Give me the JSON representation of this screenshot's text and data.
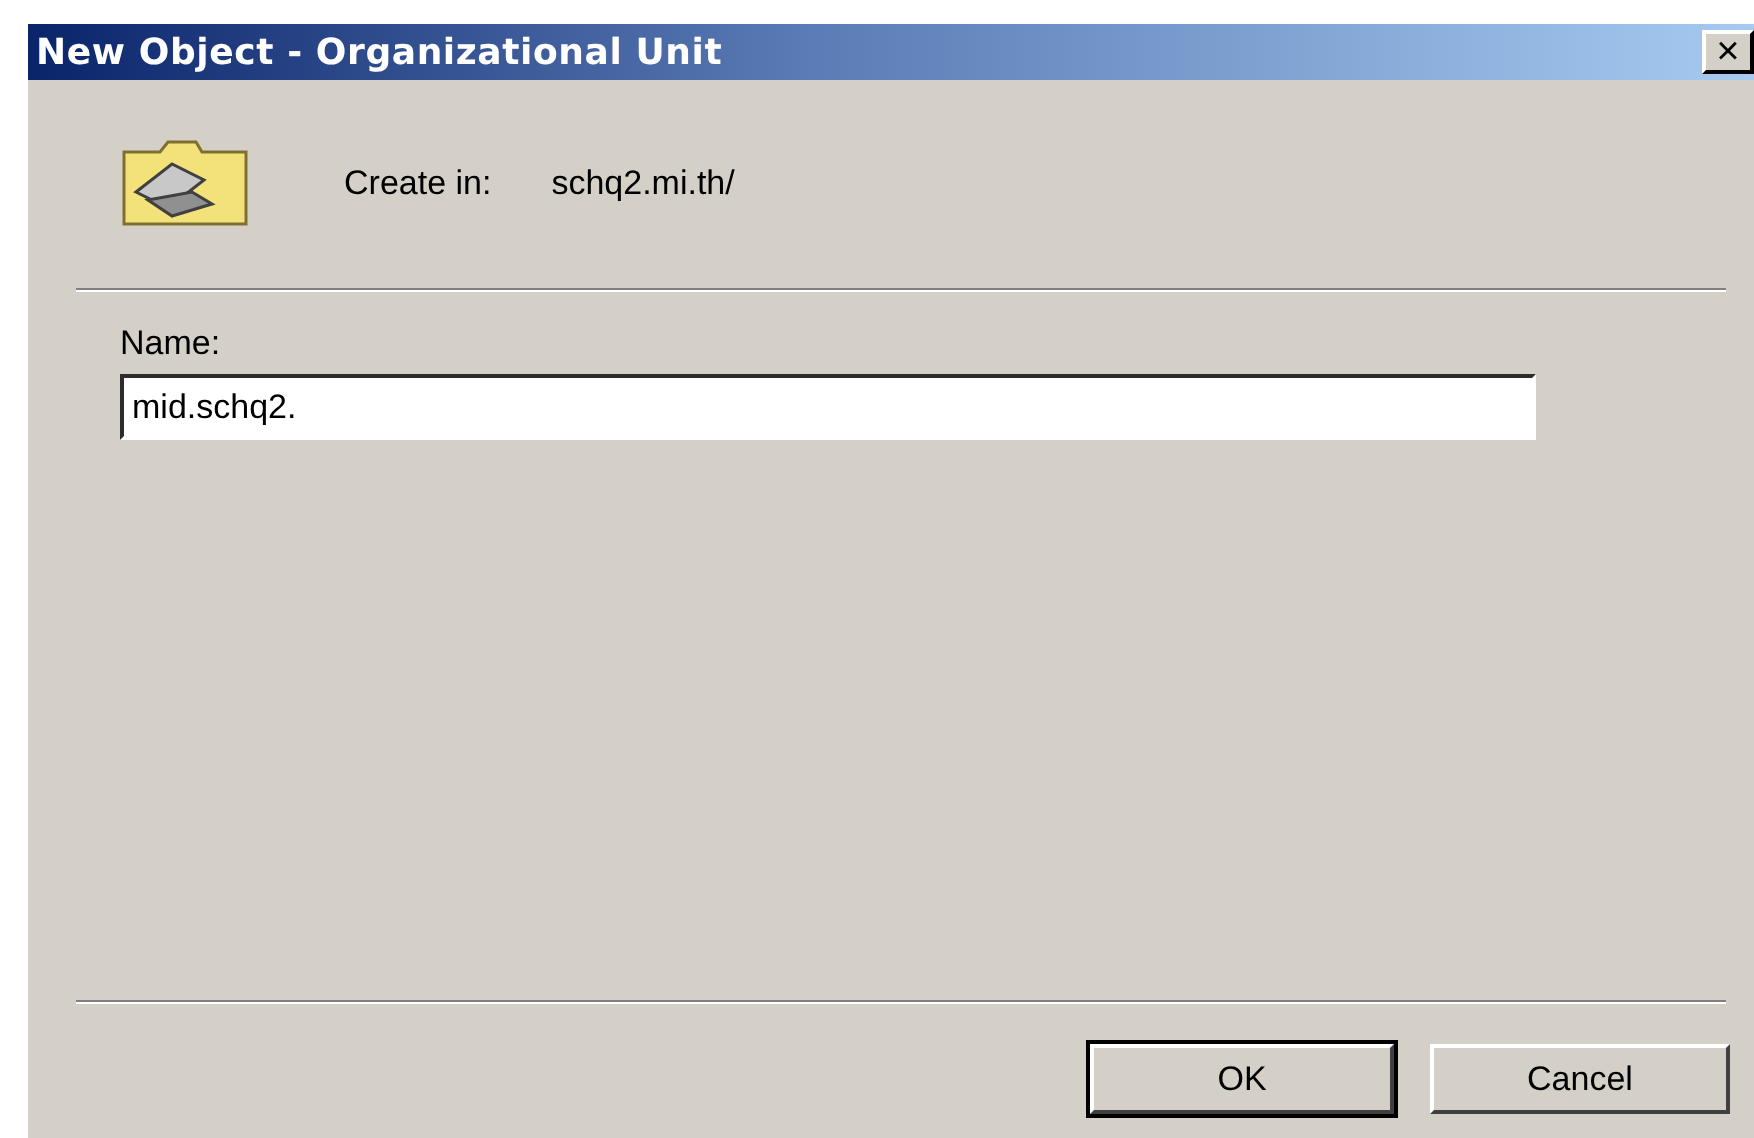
{
  "window": {
    "title": "New Object - Organizational Unit",
    "close": "×"
  },
  "location": {
    "label": "Create in:",
    "value": "schq2.mi.th/"
  },
  "name_field": {
    "label": "Name:",
    "value": "mid.schq2."
  },
  "buttons": [
    {
      "label": "OK",
      "default": true
    },
    {
      "label": "Cancel",
      "default": false
    }
  ]
}
